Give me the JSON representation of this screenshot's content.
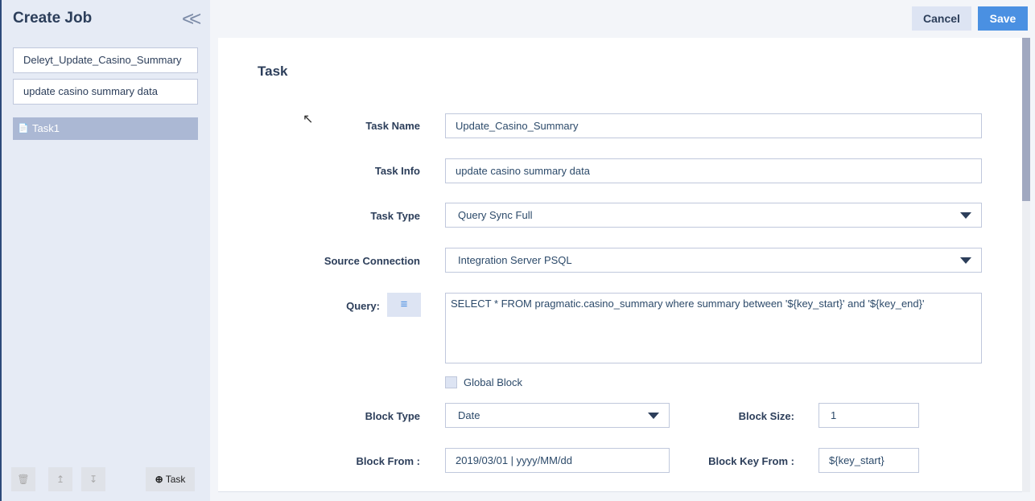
{
  "sidebar": {
    "title": "Create Job",
    "job_name": "Deleyt_Update_Casino_Summary",
    "job_info": "update casino summary data",
    "tasks": [
      {
        "label": "Task1"
      }
    ],
    "add_task_label": "Task"
  },
  "toolbar": {
    "cancel_label": "Cancel",
    "save_label": "Save"
  },
  "form": {
    "heading": "Task",
    "task_name_label": "Task Name",
    "task_name": "Update_Casino_Summary",
    "task_info_label": "Task Info",
    "task_info": "update casino summary data",
    "task_type_label": "Task Type",
    "task_type": "Query Sync Full",
    "source_label": "Source Connection",
    "source": "Integration Server PSQL",
    "query_label": "Query:",
    "query": "SELECT * FROM pragmatic.casino_summary where summary between  '${key_start}' and '${key_end}'",
    "global_block_label": "Global Block",
    "block_type_label": "Block Type",
    "block_type": "Date",
    "block_size_label": "Block Size:",
    "block_size": "1",
    "block_from_label": "Block From :",
    "block_from": "2019/03/01 | yyyy/MM/dd",
    "block_key_from_label": "Block Key From :",
    "block_key_from": "${key_start}"
  },
  "colors": {
    "save": "#4a90e2",
    "cancel": "#dde4f3",
    "sidebar": "#e6ebf5",
    "selected": "#abb8d4"
  }
}
